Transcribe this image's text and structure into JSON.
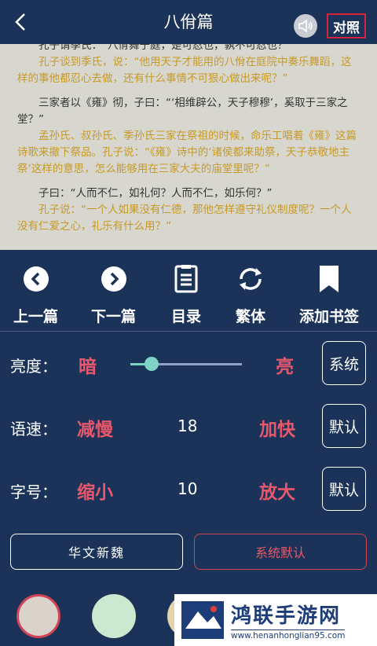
{
  "header": {
    "title": "八佾篇",
    "compare_label": "对照"
  },
  "reading": {
    "paragraphs": [
      {
        "orig": "孔子谓季氏：“八佾舞于庭，是可忍也，孰不可忍也？”",
        "trans": "孔子谈到季氏，说：“他用天子才能用的八佾在庭院中奏乐舞蹈，这样的事他都忍心去做，还有什么事情不可狠心做出来呢？”"
      },
      {
        "orig": "三家者以《雍》彻，子曰：“‘相维辟公，天子穆穆’，奚取于三家之堂？”",
        "trans": "孟孙氏、叔孙氏、季孙氏三家在祭祖的时候，命乐工唱着《雍》这篇诗歌来撤下祭品。孔子说：“《雍》诗中的‘诸侯都来助祭，天子恭敬地主祭’这样的意思，怎么能够用在三家大夫的庙堂里呢？”"
      },
      {
        "orig": "子曰：“人而不仁，如礼何？人而不仁，如乐何？”",
        "trans": "孔子说：“一个人如果没有仁德，那他怎样遵守礼仪制度呢？一个人没有仁爱之心，礼乐有什么用？”"
      }
    ]
  },
  "nav": {
    "prev": "上一篇",
    "next": "下一篇",
    "toc": "目录",
    "traditional": "繁体",
    "bookmark": "添加书签"
  },
  "brightness": {
    "label": "亮度：",
    "dark": "暗",
    "bright": "亮",
    "button": "系统",
    "level": 0.19
  },
  "speed": {
    "label": "语速：",
    "slower": "减慢",
    "value": "18",
    "faster": "加快",
    "button": "默认"
  },
  "fontsize": {
    "label": "字号：",
    "smaller": "缩小",
    "value": "10",
    "bigger": "放大",
    "button": "默认"
  },
  "fonts": {
    "font1": "华文新魏",
    "font2": "系统默认"
  },
  "swatches": [
    "#d9d3cc",
    "#c9ead0",
    "#e3d3a6"
  ],
  "watermark": {
    "name": "鸿联手游网",
    "url": "www.henanhonglian95.com"
  },
  "colors": {
    "background": "#1b3358",
    "accent_red": "#e8586c",
    "translation": "#c79a27",
    "slider": "#7fd3c6"
  }
}
